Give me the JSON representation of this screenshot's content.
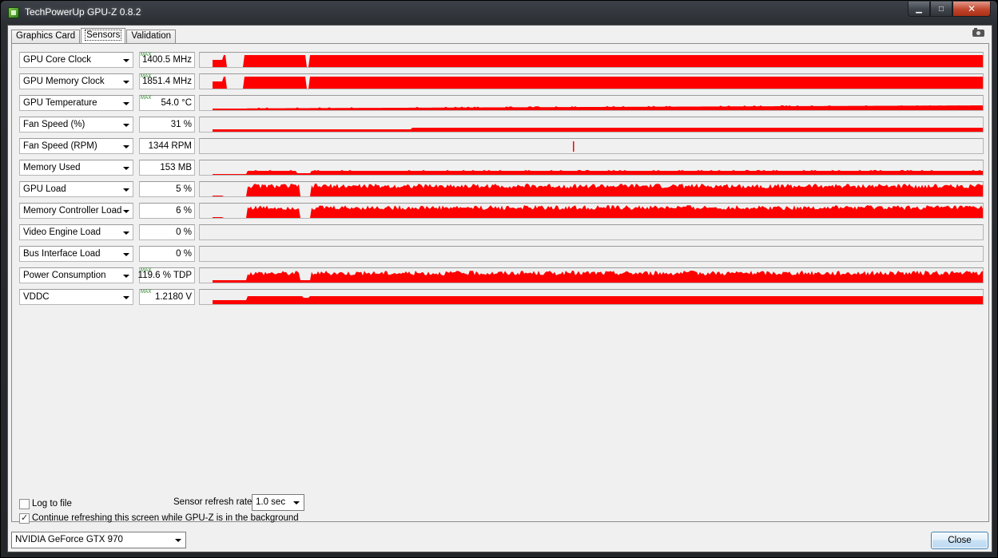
{
  "window": {
    "title": "TechPowerUp GPU-Z 0.8.2",
    "buttons": {
      "minimize": "▁",
      "maximize": "□",
      "close": "✕"
    }
  },
  "tabs": [
    {
      "label": "Graphics Card"
    },
    {
      "label": "Sensors"
    },
    {
      "label": "Validation"
    }
  ],
  "graph_color": "#ff0000",
  "sensors": [
    {
      "name": "GPU Core Clock",
      "value": "1400.5 MHz",
      "max_tag": "MAX"
    },
    {
      "name": "GPU Memory Clock",
      "value": "1851.4 MHz",
      "max_tag": "MAX"
    },
    {
      "name": "GPU Temperature",
      "value": "54.0 °C",
      "max_tag": "MAX"
    },
    {
      "name": "Fan Speed (%)",
      "value": "31 %"
    },
    {
      "name": "Fan Speed (RPM)",
      "value": "1344 RPM"
    },
    {
      "name": "Memory Used",
      "value": "153 MB"
    },
    {
      "name": "GPU Load",
      "value": "5 %"
    },
    {
      "name": "Memory Controller Load",
      "value": "6 %"
    },
    {
      "name": "Video Engine Load",
      "value": "0 %"
    },
    {
      "name": "Bus Interface Load",
      "value": "0 %"
    },
    {
      "name": "Power Consumption",
      "value": "119.6 % TDP",
      "max_tag": "MAX"
    },
    {
      "name": "VDDC",
      "value": "1.2180 V",
      "max_tag": "MAX"
    }
  ],
  "bottom": {
    "log_to_file": "Log to file",
    "log_checked": false,
    "continue_refresh": "Continue refreshing this screen while GPU-Z is in the background",
    "continue_checked": true,
    "refresh_label": "Sensor refresh rate:",
    "refresh_value": "1.0 sec",
    "gpu_select": "NVIDIA GeForce GTX 970",
    "close_label": "Close"
  }
}
